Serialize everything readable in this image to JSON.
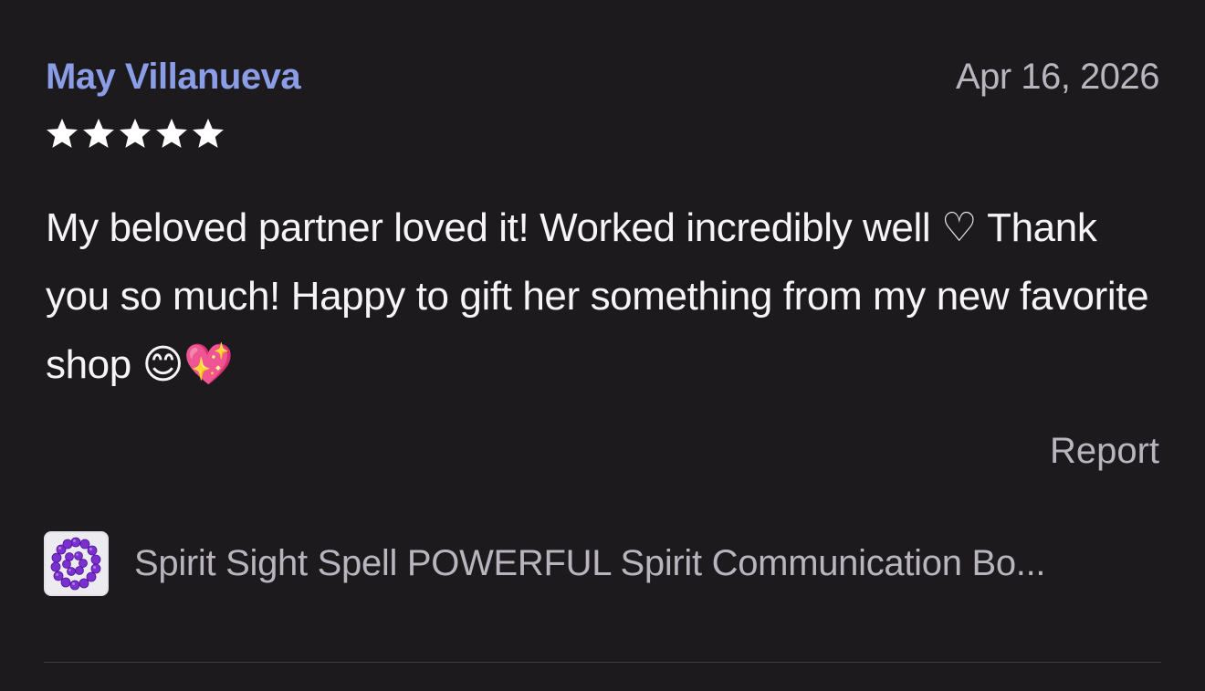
{
  "review": {
    "reviewer_name": "May Villanueva",
    "date": "Apr 16, 2026",
    "rating": 5,
    "rating_max": 5,
    "text": "My beloved partner loved it! Worked incredibly well ♡ Thank you so much! Happy to gift her something from my new favorite shop 😊💖",
    "report_label": "Report"
  },
  "product": {
    "title": "Spirit Sight Spell POWERFUL Spirit Communication Bo...",
    "thumbnail_icon": "bead-bracelet-thumbnail"
  },
  "colors": {
    "background": "#1c1a1d",
    "reviewer_name": "#8a9de6",
    "muted_text": "#b9b4bd",
    "star": "#ffffff",
    "beads": "#7b2fd0"
  }
}
